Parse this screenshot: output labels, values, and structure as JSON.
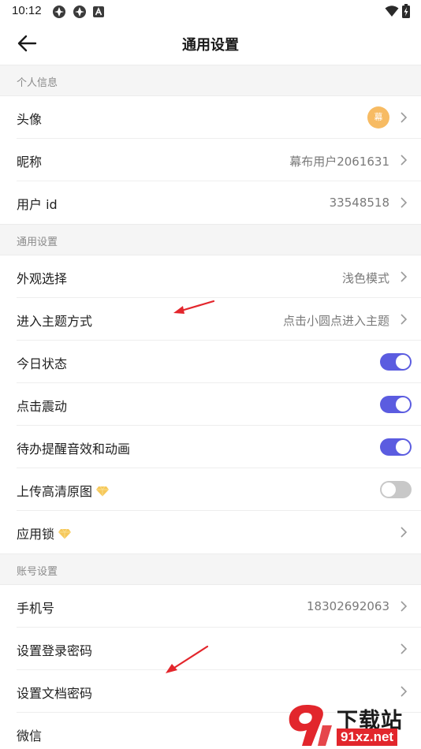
{
  "status_bar": {
    "time": "10:12",
    "icons": [
      "app-notification-icon",
      "app-notification-icon",
      "text-a-icon",
      "wifi-icon",
      "battery-charging-icon"
    ]
  },
  "header": {
    "title": "通用设置",
    "back_icon": "back-arrow-icon"
  },
  "sections": [
    {
      "title": "个人信息",
      "items": [
        {
          "label": "头像",
          "avatar_text": "幕"
        },
        {
          "label": "昵称",
          "value": "幕布用户2061631"
        },
        {
          "label": "用户 id",
          "value": "33548518"
        }
      ]
    },
    {
      "title": "通用设置",
      "items": [
        {
          "label": "外观选择",
          "value": "浅色模式"
        },
        {
          "label": "进入主题方式",
          "value": "点击小圆点进入主题"
        },
        {
          "label": "今日状态",
          "toggle": true
        },
        {
          "label": "点击震动",
          "toggle": true
        },
        {
          "label": "待办提醒音效和动画",
          "toggle": true
        },
        {
          "label": "上传高清原图",
          "toggle": false,
          "premium_icon": "diamond-icon"
        },
        {
          "label": "应用锁",
          "premium_icon": "diamond-icon"
        }
      ]
    },
    {
      "title": "账号设置",
      "items": [
        {
          "label": "手机号",
          "value": "18302692063"
        },
        {
          "label": "设置登录密码"
        },
        {
          "label": "设置文档密码"
        },
        {
          "label": "微信"
        }
      ]
    }
  ],
  "watermark": {
    "top": "下载站",
    "bottom": "91xz.net"
  },
  "colors": {
    "accent": "#5b5ce0",
    "avatar": "#f7bb63",
    "annotation_arrow": "#e3262c",
    "section_bg": "#f5f5f5"
  }
}
